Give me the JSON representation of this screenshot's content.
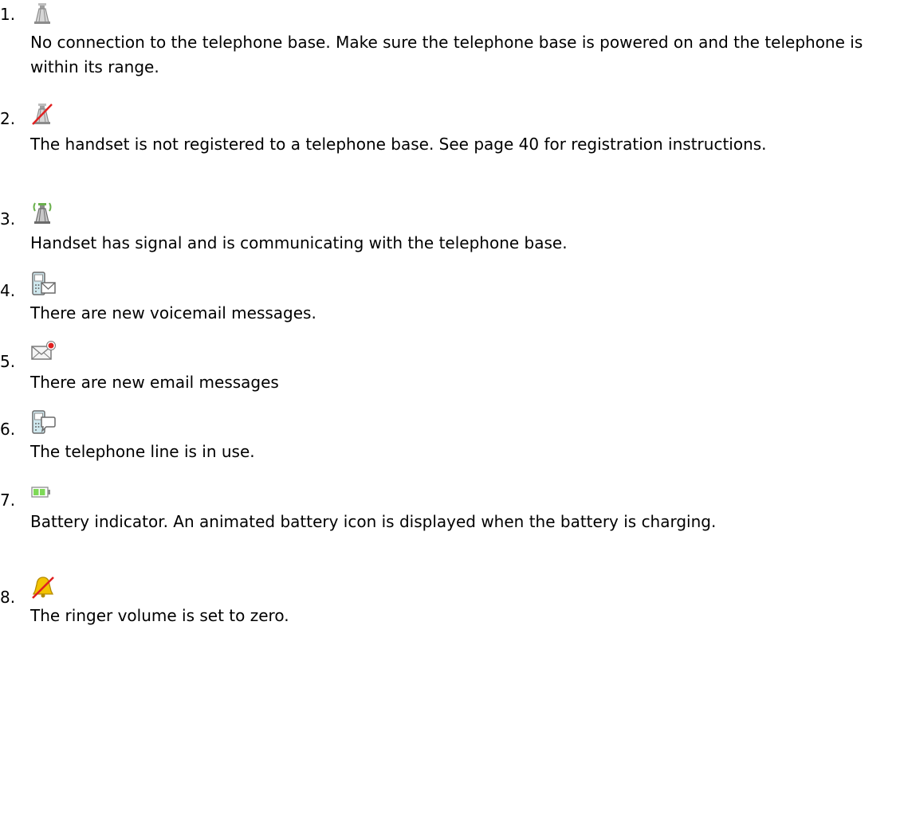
{
  "items": [
    {
      "number": "1.",
      "icon": "antenna-gray-icon",
      "text": "No connection to the telephone base. Make sure the telephone base is powered on and the telephone is within its range."
    },
    {
      "number": "2.",
      "icon": "antenna-crossed-icon",
      "text": "The handset is not registered to a telephone base. See page 40 for registration instructions."
    },
    {
      "number": "3.",
      "icon": "antenna-signal-icon",
      "text": "Handset has signal and is communicating with the telephone base."
    },
    {
      "number": "4.",
      "icon": "phone-voicemail-icon",
      "text": "There are new voicemail messages."
    },
    {
      "number": "5.",
      "icon": "envelope-new-icon",
      "text": "There are new email messages"
    },
    {
      "number": "6.",
      "icon": "phone-line-in-use-icon",
      "text": "The telephone line is in use."
    },
    {
      "number": "7.",
      "icon": "battery-icon",
      "text": "Battery indicator. An animated battery icon is displayed when the battery is charging."
    },
    {
      "number": "8.",
      "icon": "ringer-muted-icon",
      "text": "The ringer volume is set to zero."
    }
  ],
  "colors": {
    "text": "#000000",
    "icon_gray": "#8c8c8c",
    "signal_green": "#6ab04c",
    "cross_red": "#e02020",
    "battery_green": "#7ed957",
    "bell_yellow": "#f2c200",
    "phone_teal": "#cfe8ee"
  }
}
